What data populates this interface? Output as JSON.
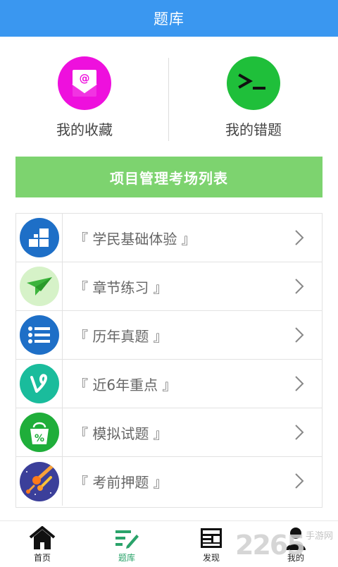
{
  "header": {
    "title": "题库"
  },
  "quick_actions": [
    {
      "label": "我的收藏",
      "icon": "mail-at-icon"
    },
    {
      "label": "我的错题",
      "icon": "terminal-icon"
    }
  ],
  "section": {
    "title": "项目管理考场列表"
  },
  "list_items": [
    {
      "label": "『 学民基础体验 』",
      "icon": "tiles-icon",
      "color": "#1e6fc7"
    },
    {
      "label": "『 章节练习 』",
      "icon": "paper-plane-icon",
      "color": "#d6f2c8"
    },
    {
      "label": "『 历年真题 』",
      "icon": "list-icon",
      "color": "#1e6fc7"
    },
    {
      "label": "『 近6年重点 』",
      "icon": "vine-icon",
      "color": "#1abc9c"
    },
    {
      "label": "『 模拟试题 』",
      "icon": "percent-bag-icon",
      "color": "#1fae3a"
    },
    {
      "label": "『 考前押题 』",
      "icon": "meteor-icon",
      "color": "#3b3f9a"
    }
  ],
  "bottom_nav": [
    {
      "label": "首页",
      "icon": "home-icon",
      "active": false
    },
    {
      "label": "题库",
      "icon": "edit-list-icon",
      "active": true
    },
    {
      "label": "发现",
      "icon": "news-icon",
      "active": false
    },
    {
      "label": "我的",
      "icon": "user-icon",
      "active": false
    }
  ],
  "watermark": {
    "text": "2265",
    "sub": "手游网"
  },
  "colors": {
    "header": "#3a97f0",
    "section": "#7dd36f",
    "active_nav": "#2aa36a"
  }
}
